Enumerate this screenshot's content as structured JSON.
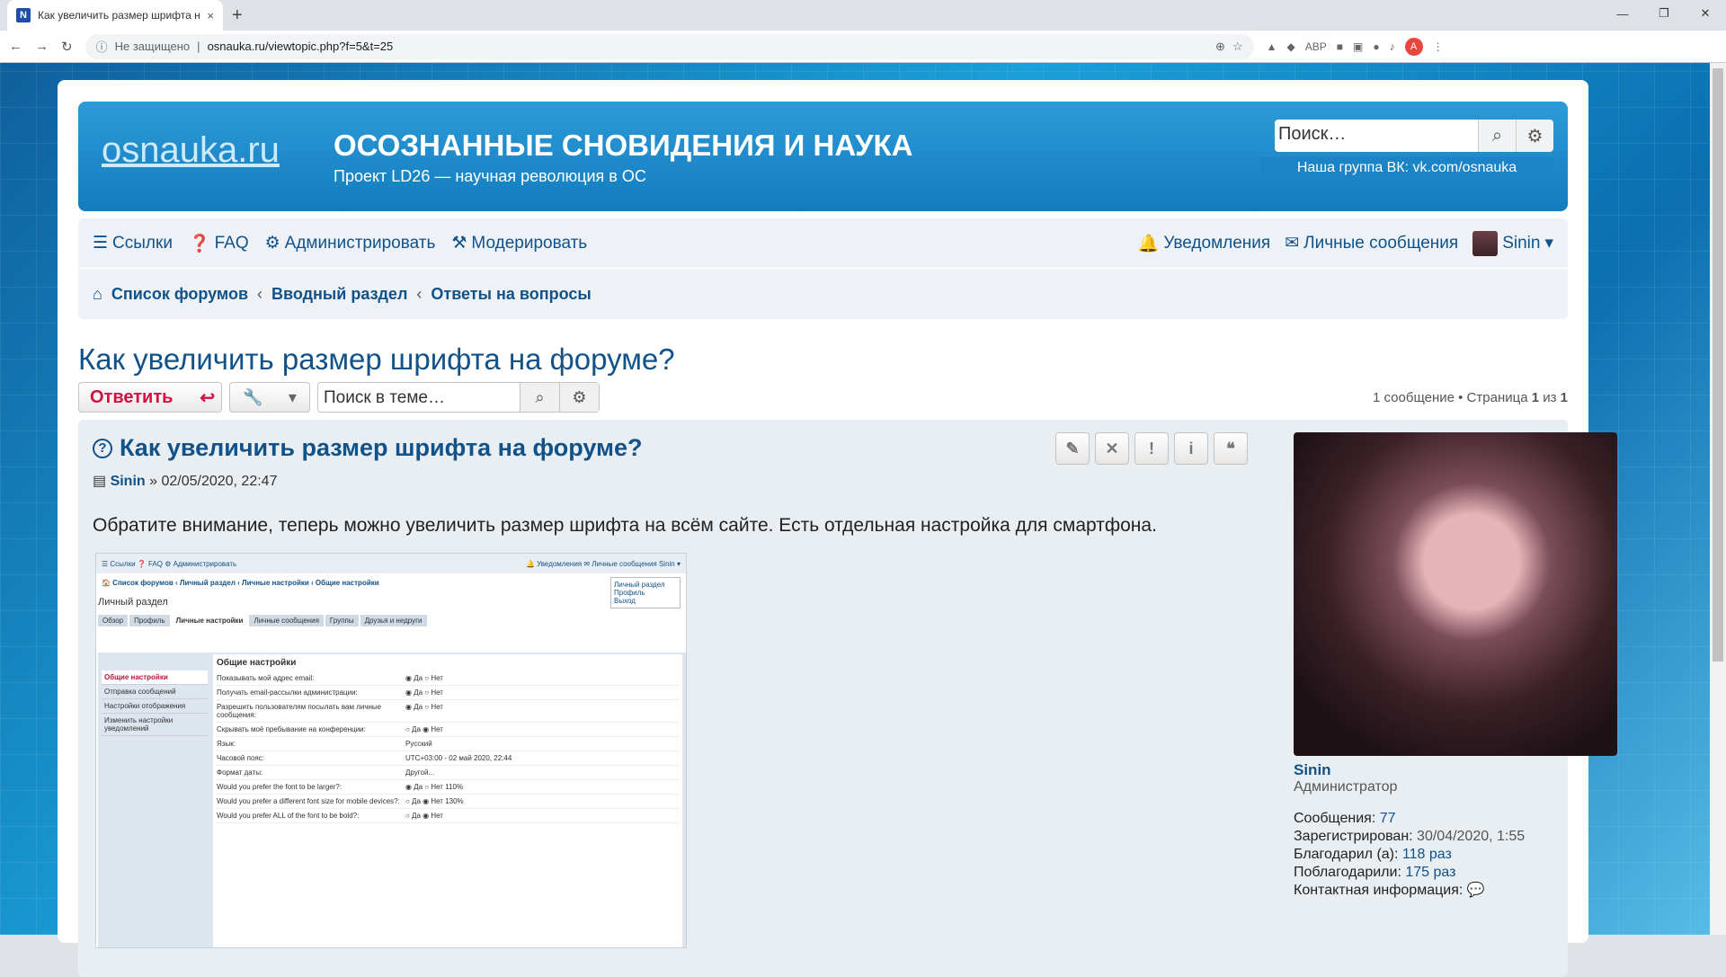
{
  "browser": {
    "tab_title": "Как увеличить размер шрифта н",
    "tab_favicon": "N",
    "tab_close": "×",
    "new_tab": "+",
    "insecure_label": "Не защищено",
    "url": "osnauka.ru/viewtopic.php?f=5&t=25",
    "profile_initial": "A",
    "ext_abp": "ABP"
  },
  "header": {
    "logo": "osnauka.ru",
    "site_title": "ОСОЗНАННЫЕ СНОВИДЕНИЯ И НАУКА",
    "site_description": "Проект LD26 — научная революция в ОС",
    "search_placeholder": "Поиск…",
    "vk_link": "Наша группа ВК: vk.com/osnauka"
  },
  "nav": {
    "links": "Ссылки",
    "faq": "FAQ",
    "admin": "Администрировать",
    "moderate": "Модерировать",
    "notifications": "Уведомления",
    "messages": "Личные сообщения",
    "username": "Sinin"
  },
  "breadcrumbs": [
    "Список форумов",
    "Вводный раздел",
    "Ответы на вопросы"
  ],
  "topic": {
    "title": "Как увеличить размер шрифта на форуме?",
    "reply_label": "Ответить",
    "search_placeholder": "Поиск в теме…",
    "pagination_prefix": "1 сообщение • Страница ",
    "page_current": "1",
    "page_of": " из ",
    "page_total": "1"
  },
  "post": {
    "title": "Как увеличить размер шрифта на форуме?",
    "author": "Sinin",
    "date": " » 02/05/2020, 22:47",
    "content": "Обратите внимание, теперь можно увеличить размер шрифта на всём сайте. Есть отдельная настройка для смартфона."
  },
  "screenshot": {
    "nav": "☰ Ссылки  ❓ FAQ  ⚙ Администрировать",
    "nav_right": "🔔 Уведомления  ✉ Личные сообщения  Sinin ▾",
    "crumbs": "🏠 Список форумов ‹ Личный раздел ‹ Личные настройки ‹ Общие настройки",
    "heading": "Личный раздел",
    "tabs": [
      "Обзор",
      "Профиль",
      "Личные настройки",
      "Личные сообщения",
      "Группы",
      "Друзья и недруги"
    ],
    "menu": [
      "Личный раздел",
      "Профиль",
      "Выход"
    ],
    "side": [
      "Общие настройки",
      "Отправка сообщений",
      "Настройки отображения",
      "Изменить настройки уведомлений"
    ],
    "form_title": "Общие настройки",
    "rows": [
      {
        "k": "Показывать мой адрес email:",
        "v": "◉ Да ○ Нет"
      },
      {
        "k": "Получать email-рассылки администрации:",
        "v": "◉ Да ○ Нет"
      },
      {
        "k": "Разрешить пользователям посылать вам личные сообщения:",
        "v": "◉ Да ○ Нет"
      },
      {
        "k": "Скрывать моё пребывание на конференции:",
        "v": "○ Да ◉ Нет"
      },
      {
        "k": "Язык:",
        "v": "Русский"
      },
      {
        "k": "Часовой пояс:",
        "v": "UTC+03:00 - 02 май 2020, 22:44"
      },
      {
        "k": "Формат даты:",
        "v": "Другой..."
      },
      {
        "k": "Would you prefer the font to be larger?:",
        "v": "◉ Да ○ Нет  110%"
      },
      {
        "k": "Would you prefer a different font size for mobile devices?:",
        "v": "○ Да ◉ Нет  130%"
      },
      {
        "k": "Would you prefer ALL of the font to be bold?:",
        "v": "○ Да ◉ Нет"
      }
    ]
  },
  "profile": {
    "name": "Sinin",
    "rank": "Администратор",
    "posts_label": "Сообщения: ",
    "posts": "77",
    "registered_label": "Зарегистрирован: ",
    "registered": "30/04/2020, 1:55",
    "thanked_label": "Благодарил (а): ",
    "thanked": "118 раз",
    "thanked_by_label": "Поблагодарили: ",
    "thanked_by": "175 раз",
    "contact_label": "Контактная информация: "
  }
}
